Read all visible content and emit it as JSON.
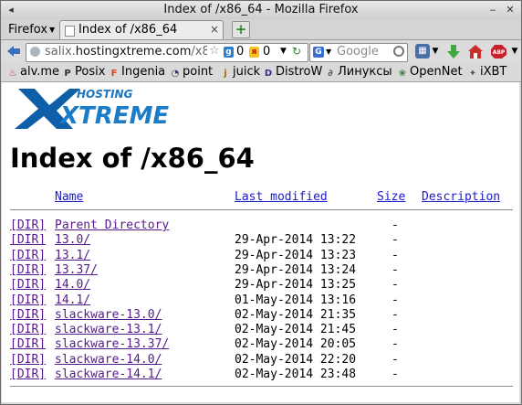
{
  "window": {
    "title": "Index of /x86_64 - Mozilla Firefox",
    "btn_left": "◂",
    "btn_min": "‒",
    "btn_close": "✕"
  },
  "tabs": {
    "firefox_menu": "Firefox",
    "active_tab": "Index of /x86_64",
    "close_glyph": "×",
    "newtab_glyph": "+"
  },
  "navbar": {
    "back_icon": "back-arrow-icon",
    "url_host": "salix.",
    "url_domain": "hostingxtreme.com",
    "url_rest": "/x8",
    "star": "☆",
    "g_count": "0",
    "y_count": "0",
    "search_engine": "G",
    "search_placeholder": "Google",
    "colors": {
      "download": "#3fa83f",
      "home": "#c8302c",
      "abp": "#c8202c"
    }
  },
  "bookmarks": [
    {
      "label": "alv.me",
      "icon": "fire-icon",
      "glyph": "♨",
      "color": "#c23"
    },
    {
      "label": "Posix",
      "icon": "p-icon",
      "glyph": "P",
      "color": "#333"
    },
    {
      "label": "Ingenia",
      "icon": "f-icon",
      "glyph": "F",
      "color": "#d42"
    },
    {
      "label": "point",
      "icon": "point-icon",
      "glyph": "◔",
      "color": "#336"
    },
    {
      "label": "juick",
      "icon": "juick-icon",
      "glyph": "j",
      "color": "#a60"
    },
    {
      "label": "DistroW",
      "icon": "distrowatch-icon",
      "glyph": "D",
      "color": "#338"
    },
    {
      "label": "Линуксы",
      "icon": "linux-icon",
      "glyph": "∂",
      "color": "#555"
    },
    {
      "label": "OpenNet",
      "icon": "opennet-icon",
      "glyph": "❀",
      "color": "#474"
    },
    {
      "label": "iXBT",
      "icon": "ixbt-icon",
      "glyph": "✦",
      "color": "#555"
    }
  ],
  "page": {
    "logo_top": "HOSTING",
    "logo_main": "XTREME",
    "heading": "Index of /x86_64",
    "columns": {
      "name": "Name",
      "modified": "Last modified",
      "size": "Size",
      "description": "Description"
    },
    "rows": [
      {
        "tag": "[DIR]",
        "name": "Parent Directory",
        "modified": "",
        "size": "-"
      },
      {
        "tag": "[DIR]",
        "name": "13.0/",
        "modified": "29-Apr-2014 13:22",
        "size": "-"
      },
      {
        "tag": "[DIR]",
        "name": "13.1/",
        "modified": "29-Apr-2014 13:23",
        "size": "-"
      },
      {
        "tag": "[DIR]",
        "name": "13.37/",
        "modified": "29-Apr-2014 13:24",
        "size": "-"
      },
      {
        "tag": "[DIR]",
        "name": "14.0/",
        "modified": "29-Apr-2014 13:25",
        "size": "-"
      },
      {
        "tag": "[DIR]",
        "name": "14.1/",
        "modified": "01-May-2014 13:16",
        "size": "-"
      },
      {
        "tag": "[DIR]",
        "name": "slackware-13.0/",
        "modified": "02-May-2014 21:35",
        "size": "-"
      },
      {
        "tag": "[DIR]",
        "name": "slackware-13.1/",
        "modified": "02-May-2014 21:45",
        "size": "-"
      },
      {
        "tag": "[DIR]",
        "name": "slackware-13.37/",
        "modified": "02-May-2014 20:05",
        "size": "-"
      },
      {
        "tag": "[DIR]",
        "name": "slackware-14.0/",
        "modified": "02-May-2014 22:20",
        "size": "-"
      },
      {
        "tag": "[DIR]",
        "name": "slackware-14.1/",
        "modified": "02-May-2014 23:48",
        "size": "-"
      }
    ]
  }
}
